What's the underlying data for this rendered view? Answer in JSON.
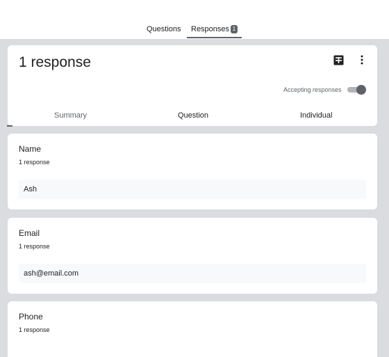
{
  "tabs": {
    "questions": "Questions",
    "responses": "Responses",
    "responses_badge": "1"
  },
  "summary": {
    "response_count": "1 response",
    "accepting_label": "Accepting responses",
    "accepting_on": true,
    "sheets_icon": "google-sheets-icon",
    "more_icon": "more-vert-icon",
    "subtabs": {
      "summary": "Summary",
      "question": "Question",
      "individual": "Individual"
    }
  },
  "questions": [
    {
      "title": "Name",
      "count": "1 response",
      "answer": "Ash"
    },
    {
      "title": "Email",
      "count": "1 response",
      "answer": "ash@email.com"
    },
    {
      "title": "Phone",
      "count": "1 response"
    }
  ],
  "colors": {
    "page_bg": "#dadce0",
    "card_bg": "#ffffff",
    "answer_bg": "#f8f9fa",
    "accent_gray": "#5f6368"
  }
}
